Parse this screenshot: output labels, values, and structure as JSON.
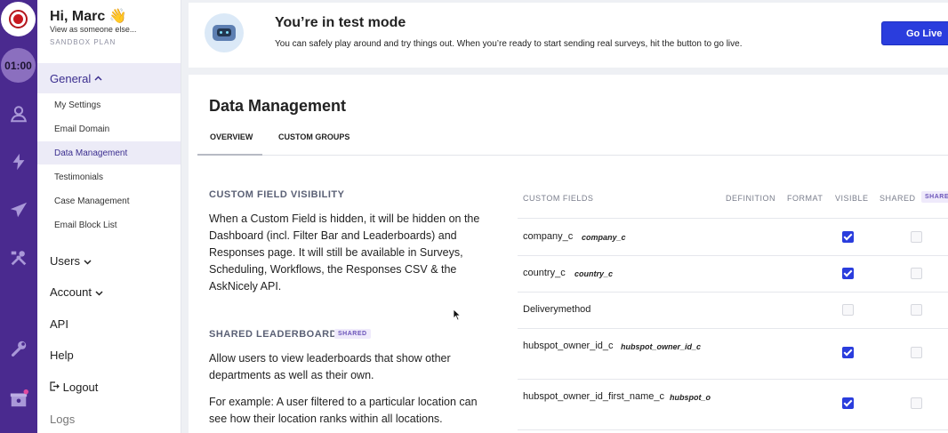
{
  "rail": {
    "timer": "01:00",
    "icons": [
      "brand-logo-icon",
      "user-icon",
      "bolt-icon",
      "paper-plane-icon",
      "tools-icon",
      "wrench-icon",
      "gift-icon"
    ]
  },
  "nav": {
    "greeting": "Hi, Marc 👋",
    "view_as": "View as someone else...",
    "plan": "SANDBOX PLAN",
    "general": "General",
    "sub_items": [
      "My Settings",
      "Email Domain",
      "Data Management",
      "Testimonials",
      "Case Management",
      "Email Block List"
    ],
    "users": "Users",
    "account": "Account",
    "api": "API",
    "help": "Help",
    "logout": "Logout",
    "logs": "Logs"
  },
  "banner": {
    "title": "You’re in test mode",
    "description": "You can safely play around and try things out. When you’re ready to start sending real surveys, hit the button to go live.",
    "button": "Go Live"
  },
  "main": {
    "title": "Data Management",
    "tabs": [
      "OVERVIEW",
      "CUSTOM GROUPS"
    ],
    "visibility": {
      "title": "CUSTOM FIELD VISIBILITY",
      "text": "When a Custom Field is hidden, it will be hidden on the Dashboard (incl. Filter Bar and Leaderboards) and Responses page. It will still be available in Surveys, Scheduling, Workflows, the Responses CSV & the AskNicely API."
    },
    "leaderboard": {
      "title": "SHARED LEADERBOARD",
      "badge": "SHARED",
      "text1": "Allow users to view leaderboards that show other departments as well as their own.",
      "text2": "For example: A user filtered to a particular location can see how their location ranks within all locations."
    }
  },
  "table": {
    "headers": [
      "CUSTOM FIELDS",
      "DEFINITION",
      "FORMAT",
      "VISIBLE",
      "SHARED"
    ],
    "header_badge": "SHARE",
    "rows": [
      {
        "name": "company_c",
        "def": "company_c",
        "visible": true,
        "shared": false
      },
      {
        "name": "country_c",
        "def": "country_c",
        "visible": true,
        "shared": false
      },
      {
        "name": "Deliverymethod",
        "def": "",
        "visible": false,
        "shared": false
      },
      {
        "name": "hubspot_owner_id_c",
        "def": "hubspot_owner_id_c",
        "visible": true,
        "shared": false
      },
      {
        "name": "hubspot_owner_id_first_name_c",
        "def": "hubspot_o",
        "visible": true,
        "shared": false
      }
    ]
  },
  "colors": {
    "rail": "#4a2a8f",
    "accent": "#2a3ddd",
    "brand_red": "#c8191f"
  }
}
